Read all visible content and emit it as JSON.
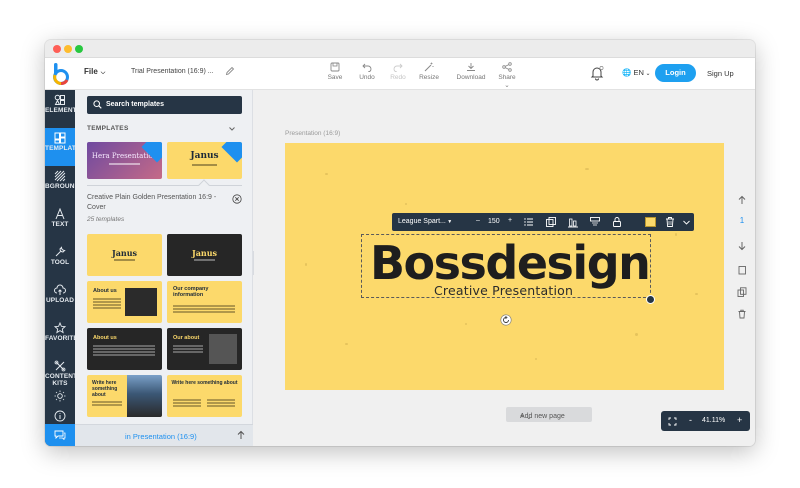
{
  "app": {
    "file_menu": "File",
    "doc_title": "Trial Presentation (16:9) ...",
    "toolbar": [
      {
        "label": "Save",
        "icon": "save-icon",
        "enabled": true
      },
      {
        "label": "Undo",
        "icon": "undo-icon",
        "enabled": true
      },
      {
        "label": "Redo",
        "icon": "redo-icon",
        "enabled": false
      },
      {
        "label": "Resize",
        "icon": "magic-wand-icon",
        "enabled": true
      },
      {
        "label": "Download",
        "icon": "download-icon",
        "enabled": true
      },
      {
        "label": "Share",
        "icon": "share-icon",
        "enabled": true
      }
    ],
    "language": "EN",
    "login_label": "Login",
    "signup_label": "Sign Up",
    "accent_color": "#1e90ef",
    "dark_color": "#263545"
  },
  "rail": [
    {
      "label": "ELEMENTS",
      "icon": "shapes-icon"
    },
    {
      "label": "TEMPLATES",
      "icon": "template-grid-icon",
      "active": true
    },
    {
      "label": "BGROUND",
      "icon": "background-pattern-icon"
    },
    {
      "label": "TEXT",
      "icon": "text-icon"
    },
    {
      "label": "TOOL",
      "icon": "wrench-icon"
    },
    {
      "label": "UPLOAD",
      "icon": "cloud-upload-icon"
    },
    {
      "label": "FAVORITES",
      "icon": "star-icon"
    },
    {
      "label": "CONTENT",
      "icon": "content-kits-icon",
      "label2": "KITS"
    }
  ],
  "panel": {
    "search_placeholder": "Search templates",
    "section_label": "TEMPLATES",
    "top_thumbs": [
      "Hera Presentation",
      "Janus"
    ],
    "template_name": "Creative Plain Golden Presentation 16:9 - Cover",
    "template_count": "25 templates",
    "cover_title": "Janus",
    "slides": [
      {
        "title": "About us"
      },
      {
        "title": "Our company information"
      },
      {
        "title": "About us"
      },
      {
        "title": "Our about"
      },
      {
        "title": "Write here something about"
      },
      {
        "title": "Write here something about"
      }
    ],
    "footer_label": "in Presentation (16:9)"
  },
  "canvas": {
    "presentation_label": "Presentation (16:9)",
    "slide_bg": "#fcd96b",
    "headline": "Bossdesign",
    "subheadline": "Creative Presentation",
    "font_name": "League Spart...",
    "font_size": "150",
    "page_number": "1",
    "add_page_label": "Add new page",
    "zoom": "41.11%"
  }
}
